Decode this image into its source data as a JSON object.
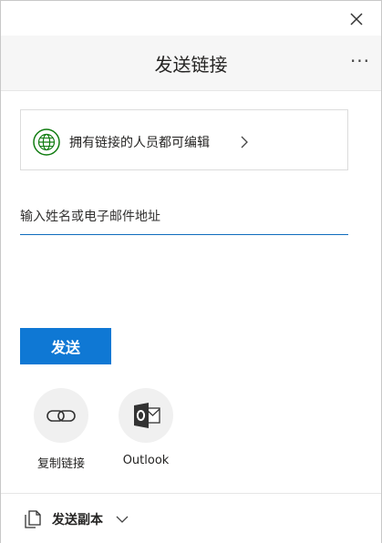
{
  "dialog": {
    "title": "发送链接",
    "close_icon": "close-icon",
    "more_icon": "more-options-icon"
  },
  "permission": {
    "text": "拥有链接的人员都可编辑",
    "icon": "globe-icon",
    "chevron_icon": "chevron-right-icon"
  },
  "recipient": {
    "placeholder": "输入姓名或电子邮件地址",
    "value": ""
  },
  "send_button": {
    "label": "发送",
    "color": "#0f78d4"
  },
  "share_options": [
    {
      "label": "复制链接",
      "icon": "link-icon"
    },
    {
      "label": "Outlook",
      "icon": "outlook-icon"
    }
  ],
  "footer": {
    "label": "发送副本",
    "icon": "copy-document-icon",
    "chevron_icon": "chevron-down-icon"
  },
  "colors": {
    "accent": "#0f78d4",
    "underline": "#0f6cbd",
    "globe_green": "#107c10",
    "header_bg": "#f6f6f6"
  }
}
